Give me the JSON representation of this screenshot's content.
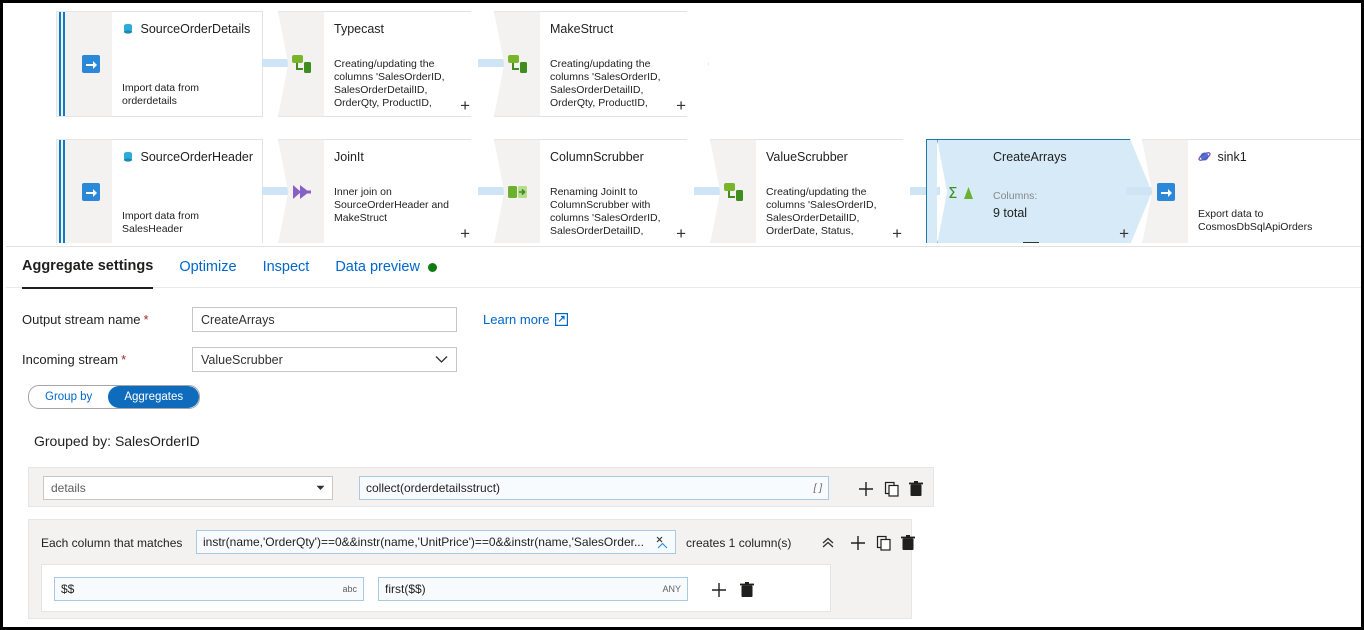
{
  "canvas": {
    "rows": [
      {
        "source": {
          "name": "SourceOrderDetails",
          "description": "Import data from orderdetails",
          "icon": "sql-database-icon",
          "source_icon": "source-import-icon"
        },
        "transforms": [
          {
            "name": "Typecast",
            "description": "Creating/updating the columns 'SalesOrderID, SalesOrderDetailID, OrderQty, ProductID, UnitPrice, UnitPriceDiscount, LineTotal",
            "icon": "derived-column-icon",
            "selected": false
          },
          {
            "name": "MakeStruct",
            "description": "Creating/updating the columns 'SalesOrderID, SalesOrderDetailID, OrderQty, ProductID, UnitPrice, UnitPriceDiscount, LineTotal",
            "icon": "derived-column-icon",
            "selected": false
          }
        ]
      },
      {
        "source": {
          "name": "SourceOrderHeader",
          "description": "Import data from SalesHeader",
          "icon": "sql-database-icon",
          "source_icon": "source-import-icon"
        },
        "transforms": [
          {
            "name": "JoinIt",
            "description": "Inner join on SourceOrderHeader and MakeStruct",
            "icon": "join-icon",
            "selected": false
          },
          {
            "name": "ColumnScrubber",
            "description": "Renaming JoinIt to ColumnScrubber with columns 'SalesOrderID, SalesOrderDetailID, OrderDate, SourceOrderDetailsHeader",
            "icon": "select-icon",
            "selected": false
          },
          {
            "name": "ValueScrubber",
            "description": "Creating/updating the columns 'SalesOrderID, SalesOrderDetailID, OrderDate, Status, SalesOrderNumber, PurchaseOrderID",
            "icon": "derived-column-icon",
            "selected": false
          },
          {
            "name": "CreateArrays",
            "columns_label": "Columns:",
            "columns_value": "9 total",
            "icon": "aggregate-icon",
            "selected": true
          }
        ],
        "sink": {
          "name": "sink1",
          "description": "Export data to CosmosDbSqlApiOrders",
          "icon": "cosmosdb-icon",
          "sink_icon": "sink-export-icon"
        }
      }
    ]
  },
  "panel": {
    "tabs": [
      {
        "label": "Aggregate settings",
        "active": true,
        "dot": false
      },
      {
        "label": "Optimize",
        "active": false,
        "dot": false
      },
      {
        "label": "Inspect",
        "active": false,
        "dot": false
      },
      {
        "label": "Data preview",
        "active": false,
        "dot": true
      }
    ],
    "fields": {
      "output_stream_label": "Output stream name",
      "output_stream_value": "CreateArrays",
      "incoming_stream_label": "Incoming stream",
      "incoming_stream_value": "ValueScrubber",
      "required_marker": "*",
      "learn_more": "Learn more"
    },
    "toggle": {
      "group_by": "Group by",
      "aggregates": "Aggregates",
      "active": "Aggregates"
    },
    "grouped_by": "Grouped by: SalesOrderID",
    "aggregate_row": {
      "column_name": "details",
      "expression": "collect(orderdetailsstruct)",
      "type_hint": "[ ]"
    },
    "pattern_row": {
      "label": "Each column that matches",
      "expression": "instr(name,'OrderQty')==0&&instr(name,'UnitPrice')==0&&instr(name,'SalesOrder...",
      "creates_label": "creates 1 column(s)",
      "name_expression": "$$",
      "name_type": "abc",
      "value_expression": "first($$)",
      "value_type": "ANY"
    }
  },
  "colors": {
    "accent_blue": "#0f6cbd",
    "link_blue": "#0066cc",
    "selected_fill": "#d6eaf8",
    "selected_border": "#1b7ba5",
    "status_green": "#107c10",
    "required_red": "#a4262c"
  }
}
